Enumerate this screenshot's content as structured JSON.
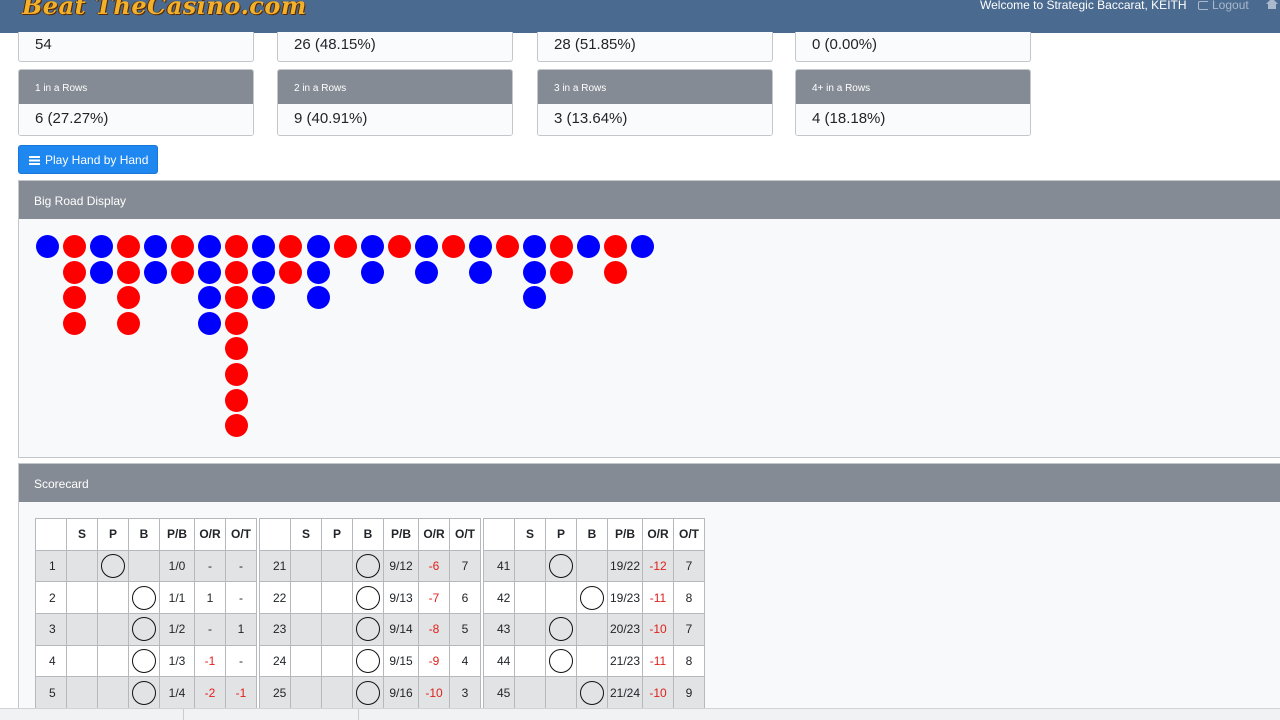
{
  "navbar": {
    "brand": "Beat TheCasino.com",
    "welcome": "Welcome to Strategic Baccarat, KEITH",
    "logout": "Logout"
  },
  "stats_top": [
    "54",
    "26 (48.15%)",
    "28 (51.85%)",
    "0 (0.00%)"
  ],
  "stats_rows": [
    {
      "label": "1 in a Rows",
      "value": "6 (27.27%)"
    },
    {
      "label": "2 in a Rows",
      "value": "9 (40.91%)"
    },
    {
      "label": "3 in a Rows",
      "value": "3 (13.64%)"
    },
    {
      "label": "4+ in a Rows",
      "value": "4 (18.18%)"
    }
  ],
  "play_button": "Play Hand by Hand",
  "big_road": {
    "title": "Big Road Display",
    "colors": {
      "player": "#0000ff",
      "banker": "#ff0000"
    },
    "columns": [
      {
        "color": "B",
        "count": 1
      },
      {
        "color": "R",
        "count": 4
      },
      {
        "color": "B",
        "count": 2
      },
      {
        "color": "R",
        "count": 4
      },
      {
        "color": "B",
        "count": 2
      },
      {
        "color": "R",
        "count": 2
      },
      {
        "color": "B",
        "count": 4
      },
      {
        "color": "R",
        "count": 8
      },
      {
        "color": "B",
        "count": 3
      },
      {
        "color": "R",
        "count": 2
      },
      {
        "color": "B",
        "count": 3
      },
      {
        "color": "R",
        "count": 1
      },
      {
        "color": "B",
        "count": 2
      },
      {
        "color": "R",
        "count": 1
      },
      {
        "color": "B",
        "count": 2
      },
      {
        "color": "R",
        "count": 1
      },
      {
        "color": "B",
        "count": 2
      },
      {
        "color": "R",
        "count": 1
      },
      {
        "color": "B",
        "count": 3
      },
      {
        "color": "R",
        "count": 2
      },
      {
        "color": "B",
        "count": 1
      },
      {
        "color": "R",
        "count": 2
      },
      {
        "color": "B",
        "count": 1
      }
    ]
  },
  "scorecard": {
    "title": "Scorecard",
    "headers": [
      "",
      "S",
      "P",
      "B",
      "P/B",
      "O/R",
      "O/T"
    ],
    "groups": [
      [
        {
          "n": "1",
          "s": "",
          "p": true,
          "b": false,
          "pb": "1/0",
          "or": "-",
          "ot": "-"
        },
        {
          "n": "2",
          "s": "",
          "p": false,
          "b": true,
          "pb": "1/1",
          "or": "1",
          "ot": "-"
        },
        {
          "n": "3",
          "s": "",
          "p": false,
          "b": true,
          "pb": "1/2",
          "or": "-",
          "ot": "1"
        },
        {
          "n": "4",
          "s": "",
          "p": false,
          "b": true,
          "pb": "1/3",
          "or": "-1",
          "ot": "-"
        },
        {
          "n": "5",
          "s": "",
          "p": false,
          "b": true,
          "pb": "1/4",
          "or": "-2",
          "ot": "-1"
        }
      ],
      [
        {
          "n": "21",
          "s": "",
          "p": false,
          "b": true,
          "pb": "9/12",
          "or": "-6",
          "ot": "7"
        },
        {
          "n": "22",
          "s": "",
          "p": false,
          "b": true,
          "pb": "9/13",
          "or": "-7",
          "ot": "6"
        },
        {
          "n": "23",
          "s": "",
          "p": false,
          "b": true,
          "pb": "9/14",
          "or": "-8",
          "ot": "5"
        },
        {
          "n": "24",
          "s": "",
          "p": false,
          "b": true,
          "pb": "9/15",
          "or": "-9",
          "ot": "4"
        },
        {
          "n": "25",
          "s": "",
          "p": false,
          "b": true,
          "pb": "9/16",
          "or": "-10",
          "ot": "3"
        }
      ],
      [
        {
          "n": "41",
          "s": "",
          "p": true,
          "b": false,
          "pb": "19/22",
          "or": "-12",
          "ot": "7"
        },
        {
          "n": "42",
          "s": "",
          "p": false,
          "b": true,
          "pb": "19/23",
          "or": "-11",
          "ot": "8"
        },
        {
          "n": "43",
          "s": "",
          "p": true,
          "b": false,
          "pb": "20/23",
          "or": "-10",
          "ot": "7"
        },
        {
          "n": "44",
          "s": "",
          "p": true,
          "b": false,
          "pb": "21/23",
          "or": "-11",
          "ot": "8"
        },
        {
          "n": "45",
          "s": "",
          "p": false,
          "b": true,
          "pb": "21/24",
          "or": "-10",
          "ot": "9"
        }
      ]
    ]
  }
}
